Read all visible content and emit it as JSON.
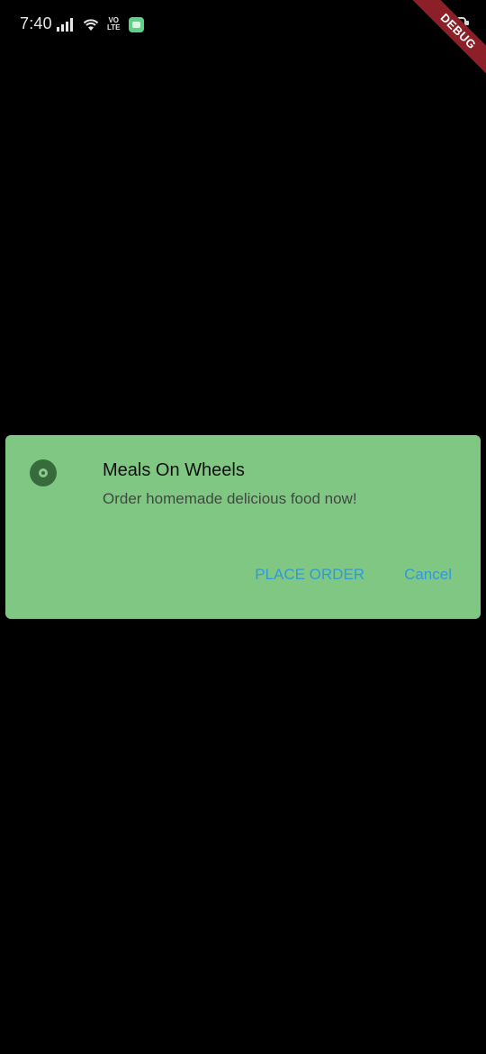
{
  "status_bar": {
    "time": "7:40",
    "icons": [
      "signal-icon",
      "wifi-icon",
      "volte-icon",
      "app-notification-icon",
      "battery-icon"
    ],
    "volte_top": "VO",
    "volte_bottom": "LTE"
  },
  "debug_banner": {
    "label": "DEBUG",
    "color": "#8c1f27"
  },
  "dialog": {
    "title": "Meals On Wheels",
    "message": "Order homemade delicious food now!",
    "icon": "app-icon",
    "background_color": "#81c784",
    "actions": {
      "place_order_label": "PLACE ORDER",
      "cancel_label": "Cancel",
      "color": "#2e9bd8"
    }
  }
}
